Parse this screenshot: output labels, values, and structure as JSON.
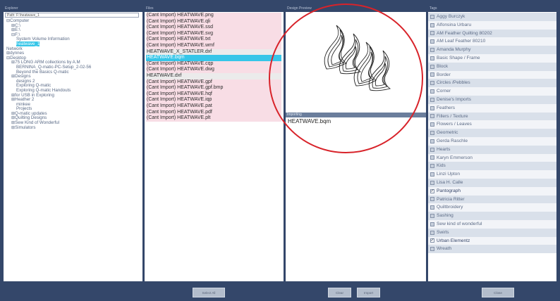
{
  "explorer": {
    "header": "Explorer",
    "path": "Path: F:\\heatwave_1",
    "tree": [
      {
        "label": "⊟Computer",
        "indent": 0
      },
      {
        "label": "⊞C:\\",
        "indent": 1
      },
      {
        "label": "⊞E:\\",
        "indent": 1
      },
      {
        "label": "⊟F:\\",
        "indent": 1
      },
      {
        "label": "System Volume Information",
        "indent": 2
      },
      {
        "label": "heatwave_1",
        "indent": 2,
        "selected": true
      },
      {
        "label": "Network",
        "indent": 0
      },
      {
        "label": "⊞dynnes",
        "indent": 0
      },
      {
        "label": "⊟Desktop",
        "indent": 0
      },
      {
        "label": "⊞75 LONG ARM collections by A.M",
        "indent": 1
      },
      {
        "label": "BERNINA_Q-matic-PC-Setup_2-02-56",
        "indent": 2
      },
      {
        "label": "Beyond the Basics Q-matic",
        "indent": 2
      },
      {
        "label": "⊞Designs",
        "indent": 1
      },
      {
        "label": "designs 2",
        "indent": 2
      },
      {
        "label": "Exploring Q-matic",
        "indent": 2
      },
      {
        "label": "Exploring Q-matic Handouts",
        "indent": 2
      },
      {
        "label": "⊞for USB in Exploring",
        "indent": 1
      },
      {
        "label": "⊞Heather 2",
        "indent": 1
      },
      {
        "label": "minkee",
        "indent": 2
      },
      {
        "label": "Projects",
        "indent": 2
      },
      {
        "label": "⊞Q-matic updates",
        "indent": 1
      },
      {
        "label": "⊞Quilting Designs",
        "indent": 1
      },
      {
        "label": "⊞Sew Kind of Wonderful",
        "indent": 1
      },
      {
        "label": "⊞Simulators",
        "indent": 1
      }
    ]
  },
  "files": {
    "header": "Files",
    "items": [
      {
        "label": "(Cant Import) HEATWAVE.png",
        "style": "pink"
      },
      {
        "label": "(Cant Import) HEATWAVE.qli",
        "style": "pink"
      },
      {
        "label": "(Cant Import) HEATWAVE.ssd",
        "style": "pink"
      },
      {
        "label": "(Cant Import) HEATWAVE.svg",
        "style": "pink"
      },
      {
        "label": "(Cant Import) HEATWAVE.txt",
        "style": "pink"
      },
      {
        "label": "(Cant Import) HEATWAVE.wmf",
        "style": "pink"
      },
      {
        "label": "HEATWAVE_X_STATLER.dxf",
        "style": "gray"
      },
      {
        "label": "HEATWAVE.bqm",
        "style": "selected"
      },
      {
        "label": "(Cant Import) HEATWAVE.cqp",
        "style": "pink"
      },
      {
        "label": "(Cant Import) HEATWAVE.dwg",
        "style": "pink"
      },
      {
        "label": "HEATWAVE.dxf",
        "style": "gray"
      },
      {
        "label": "(Cant Import) HEATWAVE.gpf",
        "style": "pink"
      },
      {
        "label": "(Cant Import) HEATWAVE.gpf.bmp",
        "style": "pink"
      },
      {
        "label": "(Cant Import) HEATWAVE.hqf",
        "style": "pink"
      },
      {
        "label": "(Cant Import) HEATWAVE.iqp",
        "style": "pink"
      },
      {
        "label": "(Cant Import) HEATWAVE.pat",
        "style": "pink"
      },
      {
        "label": "(Cant Import) HEATWAVE.pdf",
        "style": "pink"
      },
      {
        "label": "(Cant Import) HEATWAVE.plt",
        "style": "pink"
      }
    ]
  },
  "preview": {
    "header": "Design Preview",
    "selected_label": "Importing",
    "selected_file": "HEATWAVE.bqm"
  },
  "tags": {
    "header": "Tags",
    "items": [
      {
        "label": "Aggy Burczyk",
        "checked": false
      },
      {
        "label": "Alfonsina Urbaru",
        "checked": false
      },
      {
        "label": "AM Feather Quilting 80202",
        "checked": false
      },
      {
        "label": "AM Leaf Feather 80210",
        "checked": false
      },
      {
        "label": "Amanda Murphy",
        "checked": false
      },
      {
        "label": "Basic Shape / Frame",
        "checked": false
      },
      {
        "label": "Block",
        "checked": false
      },
      {
        "label": "Border",
        "checked": false
      },
      {
        "label": "Circles /Pebbles",
        "checked": false
      },
      {
        "label": "Corner",
        "checked": false
      },
      {
        "label": "Denise's Imports",
        "checked": false
      },
      {
        "label": "Feathers",
        "checked": false
      },
      {
        "label": "Fillers / Texture",
        "checked": false
      },
      {
        "label": "Flowers / Leaves",
        "checked": false
      },
      {
        "label": "Geometric",
        "checked": false
      },
      {
        "label": "Gerda Raschle",
        "checked": false
      },
      {
        "label": "Hearts",
        "checked": false
      },
      {
        "label": "Karyn Emmerson",
        "checked": false
      },
      {
        "label": "Kids",
        "checked": false
      },
      {
        "label": "Linzi Upton",
        "checked": false
      },
      {
        "label": "Lisa H. Calle",
        "checked": false
      },
      {
        "label": "Pantograph",
        "checked": true
      },
      {
        "label": "Patricia Ritter",
        "checked": false
      },
      {
        "label": "Quiltbroidery",
        "checked": false
      },
      {
        "label": "Sashing",
        "checked": false
      },
      {
        "label": "Sew kind of wonderful",
        "checked": false
      },
      {
        "label": "Swirls",
        "checked": false
      },
      {
        "label": "Urban Elementz",
        "checked": true
      },
      {
        "label": "Wreath",
        "checked": false
      }
    ]
  },
  "buttons": {
    "select_all": "Select All",
    "clear": "Clear",
    "import": "Import",
    "close": "Close"
  },
  "colors": {
    "background": "#34476a",
    "selection": "#36c6e8",
    "cant_import_row": "#f8dde5",
    "annotation_circle": "#d8232a"
  }
}
